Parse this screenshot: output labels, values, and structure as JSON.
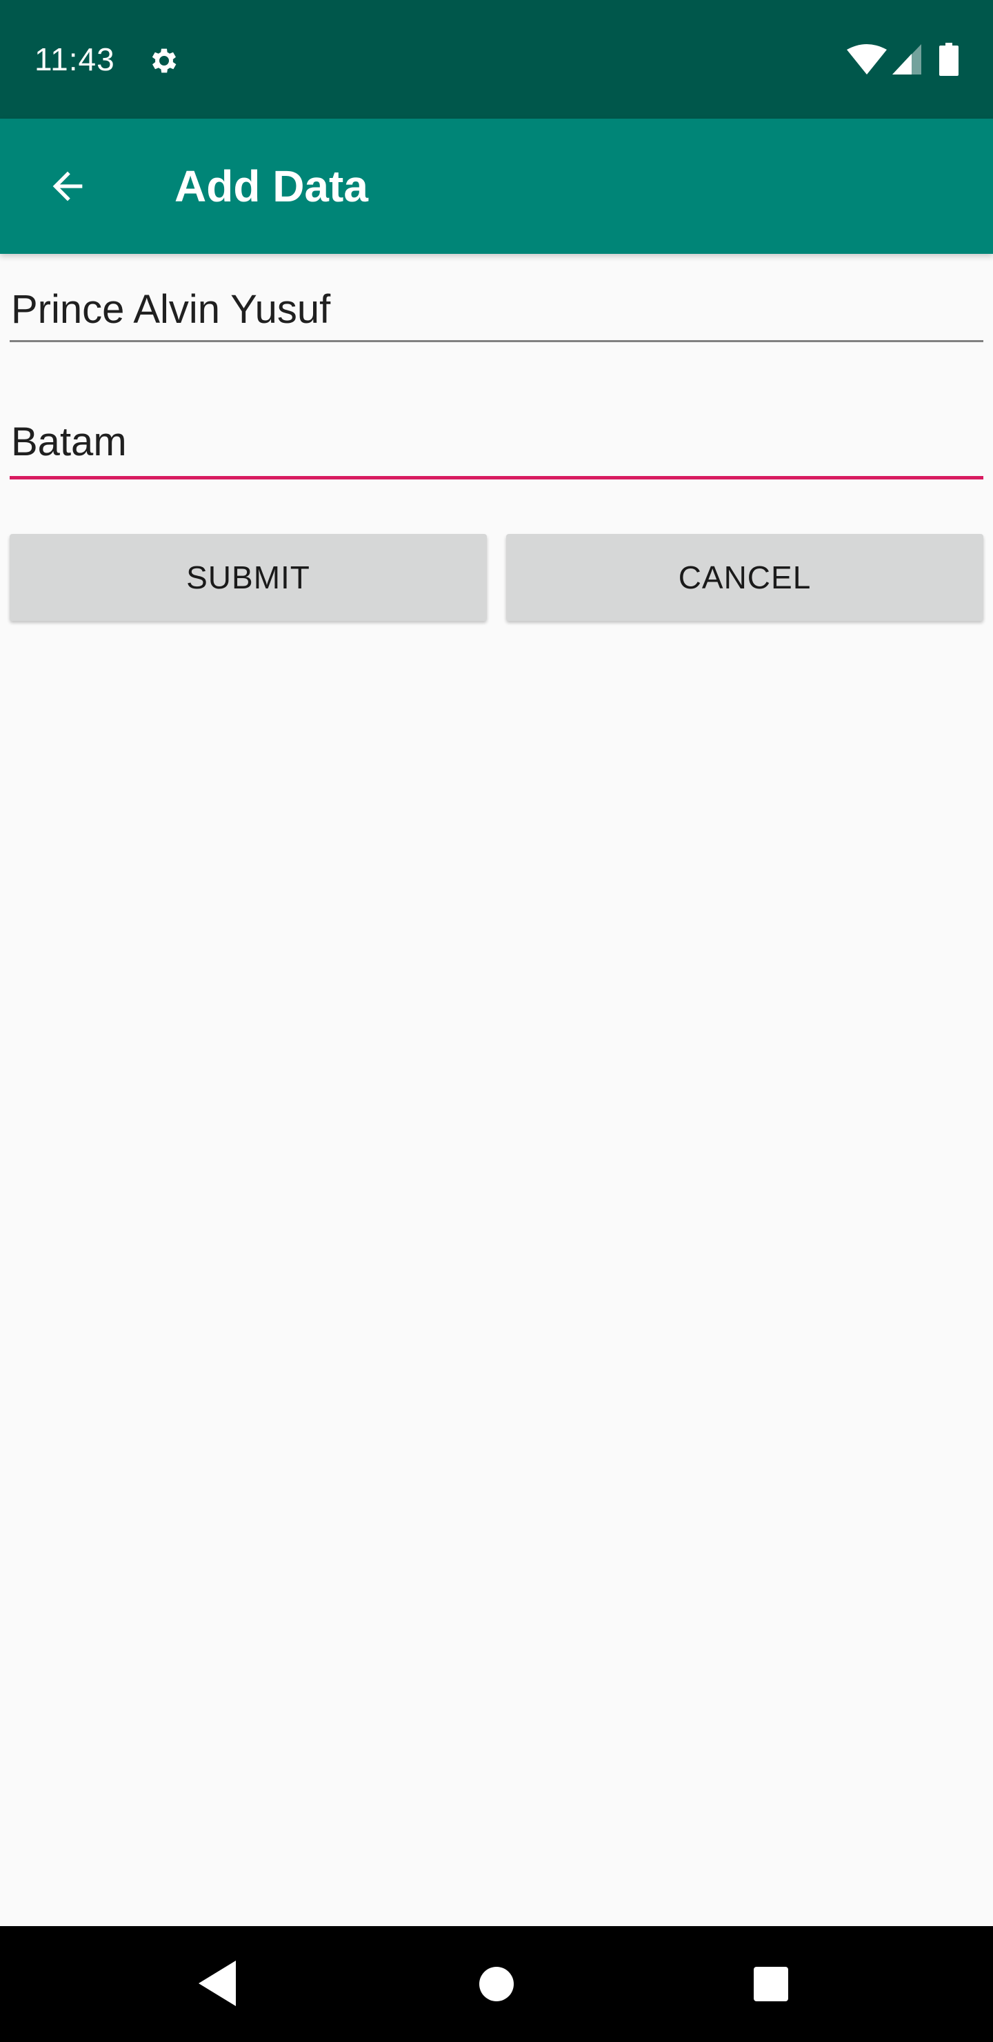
{
  "status_bar": {
    "time": "11:43",
    "icons": [
      "gear-icon",
      "wifi-icon",
      "signal-icon",
      "battery-icon"
    ],
    "background_color": "#00574b"
  },
  "app_bar": {
    "title": "Add Data",
    "back_icon": "arrow-left-icon",
    "background_color": "#008577"
  },
  "form": {
    "name_field": {
      "value": "Prince Alvin Yusuf"
    },
    "city_field": {
      "value": "Batam",
      "focused": true,
      "accent_color": "#d81b60"
    },
    "submit_label": "SUBMIT",
    "cancel_label": "CANCEL"
  },
  "nav_bar": {
    "icons": [
      "back-triangle-icon",
      "home-circle-icon",
      "recents-square-icon"
    ]
  }
}
